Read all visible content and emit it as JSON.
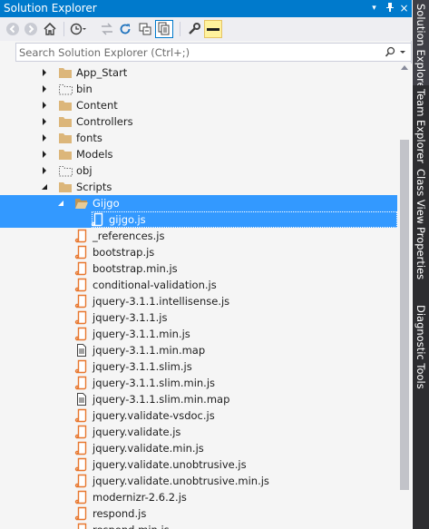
{
  "panel": {
    "title": "Solution Explorer"
  },
  "titlebar": {
    "dropdown_icon": "▾",
    "pin_icon": "pin",
    "close_icon": "×"
  },
  "toolbar": {
    "buttons": [
      "back-icon",
      "forward-icon",
      "home-icon",
      "history-icon",
      "sync-icon",
      "refresh-icon",
      "collapse-all-icon",
      "show-all-files-icon",
      "properties-icon",
      "preview-icon"
    ]
  },
  "search": {
    "placeholder": "Search Solution Explorer (Ctrl+;)",
    "value": ""
  },
  "tree": {
    "items": [
      {
        "label": "App_Start"
      },
      {
        "label": "bin"
      },
      {
        "label": "Content"
      },
      {
        "label": "Controllers"
      },
      {
        "label": "fonts"
      },
      {
        "label": "Models"
      },
      {
        "label": "obj"
      },
      {
        "label": "Scripts"
      },
      {
        "label": "Gijgo"
      },
      {
        "label": "gijgo.js"
      },
      {
        "label": "_references.js"
      },
      {
        "label": "bootstrap.js"
      },
      {
        "label": "bootstrap.min.js"
      },
      {
        "label": "conditional-validation.js"
      },
      {
        "label": "jquery-3.1.1.intellisense.js"
      },
      {
        "label": "jquery-3.1.1.js"
      },
      {
        "label": "jquery-3.1.1.min.js"
      },
      {
        "label": "jquery-3.1.1.min.map"
      },
      {
        "label": "jquery-3.1.1.slim.js"
      },
      {
        "label": "jquery-3.1.1.slim.min.js"
      },
      {
        "label": "jquery-3.1.1.slim.min.map"
      },
      {
        "label": "jquery.validate-vsdoc.js"
      },
      {
        "label": "jquery.validate.js"
      },
      {
        "label": "jquery.validate.min.js"
      },
      {
        "label": "jquery.validate.unobtrusive.js"
      },
      {
        "label": "jquery.validate.unobtrusive.min.js"
      },
      {
        "label": "modernizr-2.6.2.js"
      },
      {
        "label": "respond.js"
      },
      {
        "label": "respond.min.js"
      }
    ]
  },
  "side_tabs": [
    {
      "label": "Solution Explorer"
    },
    {
      "label": "Team Explorer"
    },
    {
      "label": "Class View"
    },
    {
      "label": "Properties"
    },
    {
      "label": "Diagnostic Tools"
    }
  ],
  "colors": {
    "accent": "#007ACC",
    "selection": "#3399FF",
    "folder": "#DCB67A",
    "js_file": "#E8772E"
  }
}
